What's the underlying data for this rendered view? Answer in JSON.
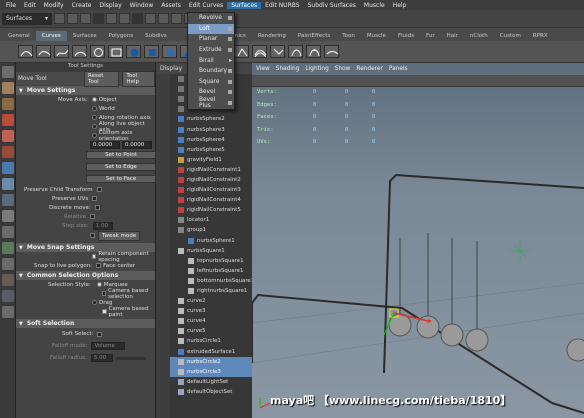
{
  "menubar": {
    "items": [
      "File",
      "Edit",
      "Modify",
      "Create",
      "Display",
      "Window",
      "Assets",
      "Edit Curves",
      "Surfaces",
      "Edit NURBS",
      "Subdiv Surfaces",
      "Muscle",
      "Help"
    ]
  },
  "statusline": {
    "menu_set": "Surfaces"
  },
  "shelf": {
    "tabs": [
      "General",
      "Curves",
      "Surfaces",
      "Polygons",
      "Subdivs",
      "",
      "",
      "",
      "",
      "",
      "Dynamics",
      "Rendering",
      "PaintEffects",
      "Toon",
      "Muscle",
      "Fluids",
      "Fur",
      "Hair",
      "nCloth",
      "Custom",
      "RPRX"
    ]
  },
  "surfaces_menu": {
    "items": [
      "Revolve",
      "Loft",
      "Planar",
      "Extrude",
      "Birail",
      "Boundary",
      "Square",
      "Bevel",
      "Bevel Plus"
    ]
  },
  "tool_settings": {
    "title": "Tool Settings",
    "tool_name": "Move Tool",
    "reset_label": "Reset Tool",
    "help_label": "Tool Help",
    "move_settings": {
      "header": "Move Settings",
      "move_axis_label": "Move Axis:",
      "axis_options": [
        "Object",
        "World",
        "Along rotation axis",
        "Along live object axis",
        "Custom axis orientation"
      ],
      "v1": "0.0000",
      "v2": "0.0000",
      "set_buttons": [
        "Set to Point",
        "Set to Edge",
        "Set to Face"
      ],
      "preserve_child": "Preserve Child Transform",
      "preserve_uvs": "Preserve UVs",
      "discrete_move": "Discrete move:",
      "relative": "Relative",
      "step_size": "Step size:",
      "step_value": "1.00",
      "tweak_mode": "Tweak mode"
    },
    "move_snap": {
      "header": "Move Snap Settings",
      "retain": "Retain component spacing",
      "snap_live": "Snap to live polygon:",
      "face_center": "Face center"
    },
    "common": {
      "header": "Common Selection Options",
      "selection_style": "Selection Style:",
      "marquee": "Marquee",
      "camera_based1": "Camera based selection",
      "drag": "Drag",
      "camera_based2": "Camera based paint"
    },
    "soft": {
      "header": "Soft Selection",
      "soft_select": "Soft Select:",
      "falloff_mode": "Falloff mode:",
      "falloff_mode_value": "Volume",
      "falloff_radius": "Falloff radius:",
      "falloff_radius_value": "5.00"
    }
  },
  "outliner": {
    "display_label": "Display",
    "items": [
      "persp",
      "top",
      "front",
      "side",
      "nurbsSphere2",
      "nurbsSphere3",
      "nurbsSphere4",
      "nurbsSphere5",
      "gravityField1",
      "rigidNailConstraint1",
      "rigidNailConstraint2",
      "rigidNailConstraint3",
      "rigidNailConstraint4",
      "rigidNailConstraint5",
      "locator1",
      "group1",
      "nurbsSphere1",
      "nurbsSquare1",
      "topnurbsSquare1",
      "leftnurbsSquare1",
      "bottomnurbsSquare1",
      "rightnurbsSquare1",
      "curve2",
      "curve3",
      "curve4",
      "curve5",
      "nurbsCircle1",
      "extrudedSurface1",
      "nurbsCircle2",
      "nurbsCircle3",
      "defaultLightSet",
      "defaultObjectSet"
    ],
    "selected": [
      28,
      29
    ]
  },
  "viewport": {
    "menu": [
      "View",
      "Shading",
      "Lighting",
      "Show",
      "Renderer",
      "Panels"
    ],
    "hud_labels": [
      "Verts:",
      "Edges:",
      "Faces:",
      "Tris:",
      "UVs:"
    ],
    "hud_values": [
      "0",
      "0",
      "0",
      "0",
      "0"
    ]
  },
  "watermark": "maya吧 【www.linecg.com/tieba/1810】"
}
